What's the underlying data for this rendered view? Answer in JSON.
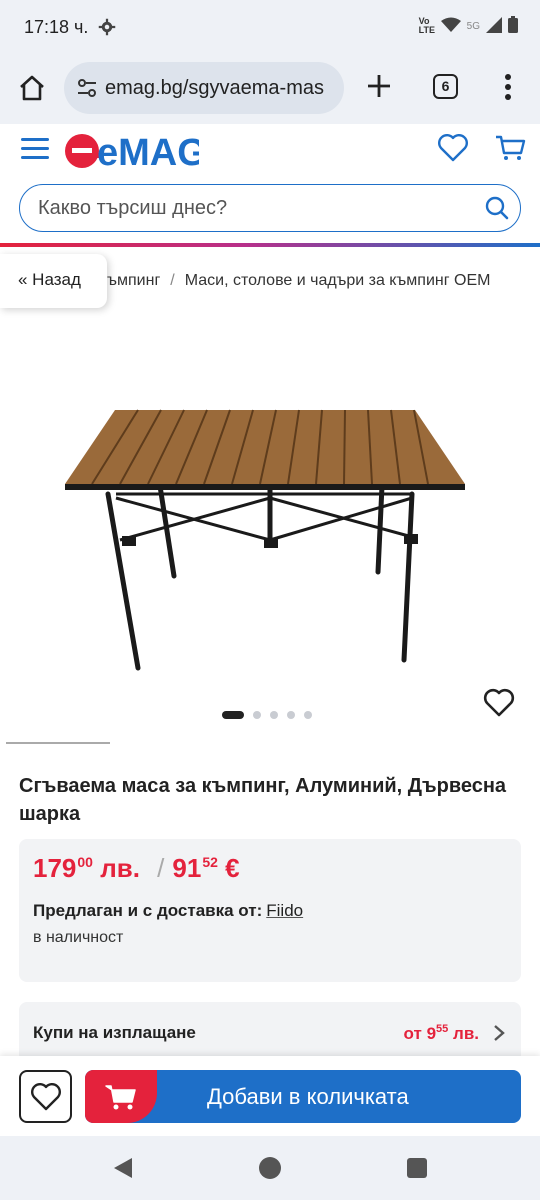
{
  "status_bar": {
    "time": "17:18 ч.",
    "network_label": "5G",
    "volte_label": "Vo LTE"
  },
  "browser": {
    "url": "emag.bg/sgyvaema-mas",
    "tab_count": "6"
  },
  "header": {
    "logo_text": "eMAG",
    "search_placeholder": "Какво търсиш днес?"
  },
  "breadcrumb": {
    "back_label": "« Назад",
    "items": [
      "къмпинг",
      "Маси, столове и чадъри за къмпинг OEM"
    ]
  },
  "gallery": {
    "image_count": 5,
    "active_index": 0
  },
  "product": {
    "title": "Сгъваема маса за къмпинг, Алуминий, Дървесна шарка",
    "price_bgn_main": "179",
    "price_bgn_cents": "00",
    "price_bgn_currency": "лв.",
    "price_eur_main": "91",
    "price_eur_cents": "52",
    "price_eur_currency": "€",
    "seller_label": "Предлаган и с доставка от:",
    "seller_name": "Fiido",
    "stock_status": "в наличност"
  },
  "installment": {
    "label": "Купи на изплащане",
    "prefix": "от",
    "price_main": "9",
    "price_cents": "55",
    "currency": "лв."
  },
  "action_bar": {
    "add_to_cart_label": "Добави в количката"
  },
  "colors": {
    "brand_blue": "#1e6fc8",
    "brand_red": "#e4223c"
  }
}
